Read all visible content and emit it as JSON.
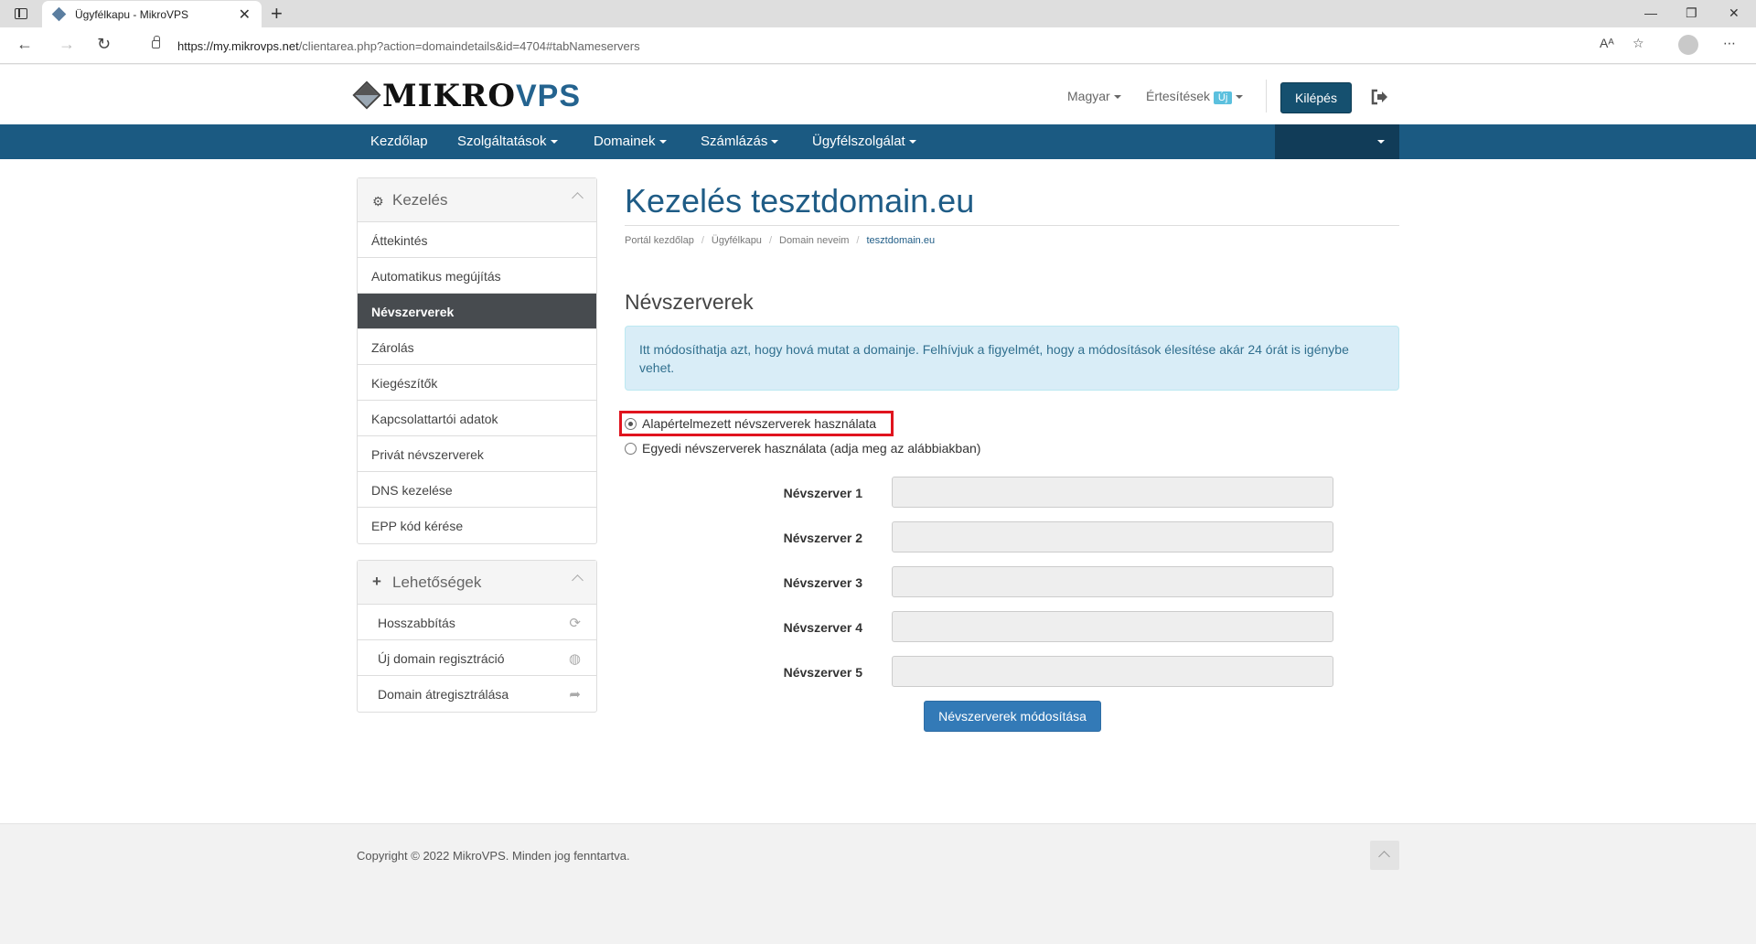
{
  "browser": {
    "tab_title": "Ügyfélkapu - MikroVPS",
    "url_domain": "https://my.mikrovps.net",
    "url_path": "/clientarea.php?action=domaindetails&id=4704#tabNameservers"
  },
  "header": {
    "logo_main": "MIKRO",
    "logo_accent": "VPS",
    "language": "Magyar",
    "notifications": "Értesítések",
    "notifications_badge": "Új",
    "logout": "Kilépés"
  },
  "nav": {
    "items": [
      {
        "label": "Kezdőlap"
      },
      {
        "label": "Szolgáltatások"
      },
      {
        "label": "Domainek"
      },
      {
        "label": "Számlázás"
      },
      {
        "label": "Ügyfélszolgálat"
      }
    ]
  },
  "sidebar": {
    "manage": {
      "title": "Kezelés",
      "items": [
        {
          "label": "Áttekintés"
        },
        {
          "label": "Automatikus megújítás"
        },
        {
          "label": "Névszerverek"
        },
        {
          "label": "Zárolás"
        },
        {
          "label": "Kiegészítők"
        },
        {
          "label": "Kapcsolattartói adatok"
        },
        {
          "label": "Privát névszerverek"
        },
        {
          "label": "DNS kezelése"
        },
        {
          "label": "EPP kód kérése"
        }
      ]
    },
    "options": {
      "title": "Lehetőségek",
      "items": [
        {
          "label": "Hosszabbítás"
        },
        {
          "label": "Új domain regisztráció"
        },
        {
          "label": "Domain átregisztrálása"
        }
      ]
    }
  },
  "main": {
    "title": "Kezelés tesztdomain.eu",
    "breadcrumbs": [
      "Portál kezdőlap",
      "Ügyfélkapu",
      "Domain neveim",
      "tesztdomain.eu"
    ],
    "section_title": "Névszerverek",
    "info": "Itt módosíthatja azt, hogy hová mutat a domainje. Felhívjuk a figyelmét, hogy a módosítások élesítése akár 24 órát is igénybe vehet.",
    "radio_default": "Alapértelmezett névszerverek használata",
    "radio_custom": "Egyedi névszerverek használata (adja meg az alábbiakban)",
    "ns_labels": [
      "Névszerver 1",
      "Névszerver 2",
      "Névszerver 3",
      "Névszerver 4",
      "Névszerver 5"
    ],
    "ns_values": [
      "",
      "",
      "",
      "",
      ""
    ],
    "submit": "Névszerverek módosítása"
  },
  "footer": {
    "copyright": "Copyright © 2022 MikroVPS. Minden jog fenntartva."
  }
}
